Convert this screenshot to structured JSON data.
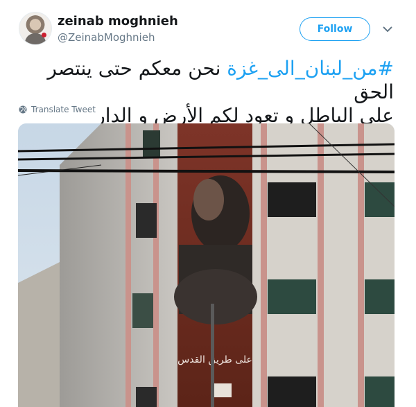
{
  "tweet": {
    "display_name": "zeinab moghnieh",
    "handle": "@ZeinabMoghnieh",
    "follow_label": "Follow",
    "hashtag": "#من_لبنان_الى_غزة",
    "line1_rest": " نحن معكم حتى ينتصر الحق",
    "line2": "على الباطل و تعود لكم الأرض و الدار",
    "translate_label": "Translate Tweet"
  },
  "media": {
    "banner_text": "على طريق القدس"
  },
  "colors": {
    "accent": "#1da1f2",
    "text": "#14171a",
    "muted": "#657786"
  }
}
